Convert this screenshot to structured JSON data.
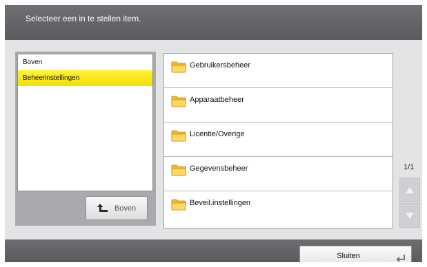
{
  "header": {
    "title": "Selecteer een in te stellen item."
  },
  "tree": {
    "items": [
      {
        "label": "Boven",
        "selected": false
      },
      {
        "label": "Beheerinstellingen",
        "selected": true
      }
    ],
    "up_button_label": "Boven",
    "up_icon": "up-arrow-icon"
  },
  "list": {
    "items": [
      {
        "label": "Gebruikersbeheer",
        "icon": "folder-icon"
      },
      {
        "label": "Apparaatbeheer",
        "icon": "folder-icon"
      },
      {
        "label": "Licentie/Overige",
        "icon": "folder-icon"
      },
      {
        "label": "Gegevensbeheer",
        "icon": "folder-icon"
      },
      {
        "label": "Beveil.instellingen",
        "icon": "folder-icon"
      }
    ]
  },
  "pagination": {
    "indicator": "1/1"
  },
  "footer": {
    "close_label": "Sluiten",
    "close_icon": "enter-icon"
  },
  "colors": {
    "header_bg": "#5f6063",
    "selection": "#fff200",
    "folder": "#f5c842"
  }
}
